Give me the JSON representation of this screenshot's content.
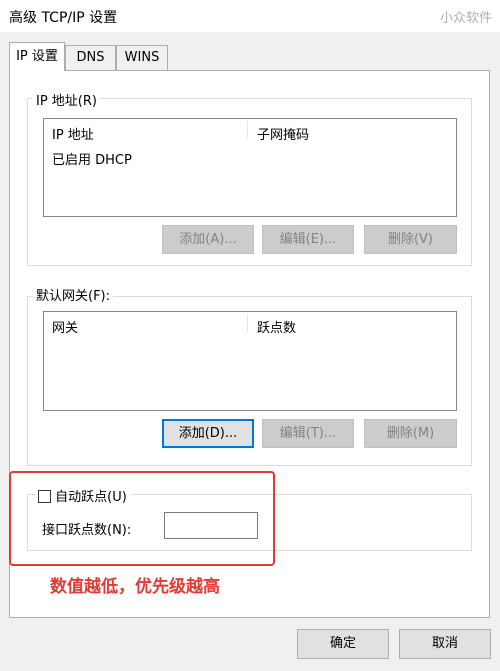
{
  "window": {
    "title": "高级 TCP/IP 设置",
    "watermark": "小众软件"
  },
  "tabs": [
    {
      "label": "IP 设置",
      "active": true
    },
    {
      "label": "DNS",
      "active": false
    },
    {
      "label": "WINS",
      "active": false
    }
  ],
  "ip_group": {
    "label": "IP 地址(R)",
    "columns": [
      "IP 地址",
      "子网掩码"
    ],
    "rows": [
      [
        "已启用 DHCP",
        ""
      ]
    ],
    "buttons": {
      "add": "添加(A)...",
      "edit": "编辑(E)...",
      "delete": "删除(V)"
    }
  },
  "gateway_group": {
    "label": "默认网关(F):",
    "columns": [
      "网关",
      "跃点数"
    ],
    "rows": [],
    "buttons": {
      "add": "添加(D)...",
      "edit": "编辑(T)...",
      "delete": "删除(M)"
    }
  },
  "metric": {
    "auto_label": "自动跃点(U)",
    "auto_checked": false,
    "interface_label": "接口跃点数(N):",
    "interface_value": ""
  },
  "annotation": {
    "text": "数值越低，优先级越高",
    "color": "#e53935"
  },
  "footer": {
    "ok": "确定",
    "cancel": "取消"
  },
  "colors": {
    "accent": "#0078d7",
    "annotation_red": "#e53935"
  }
}
